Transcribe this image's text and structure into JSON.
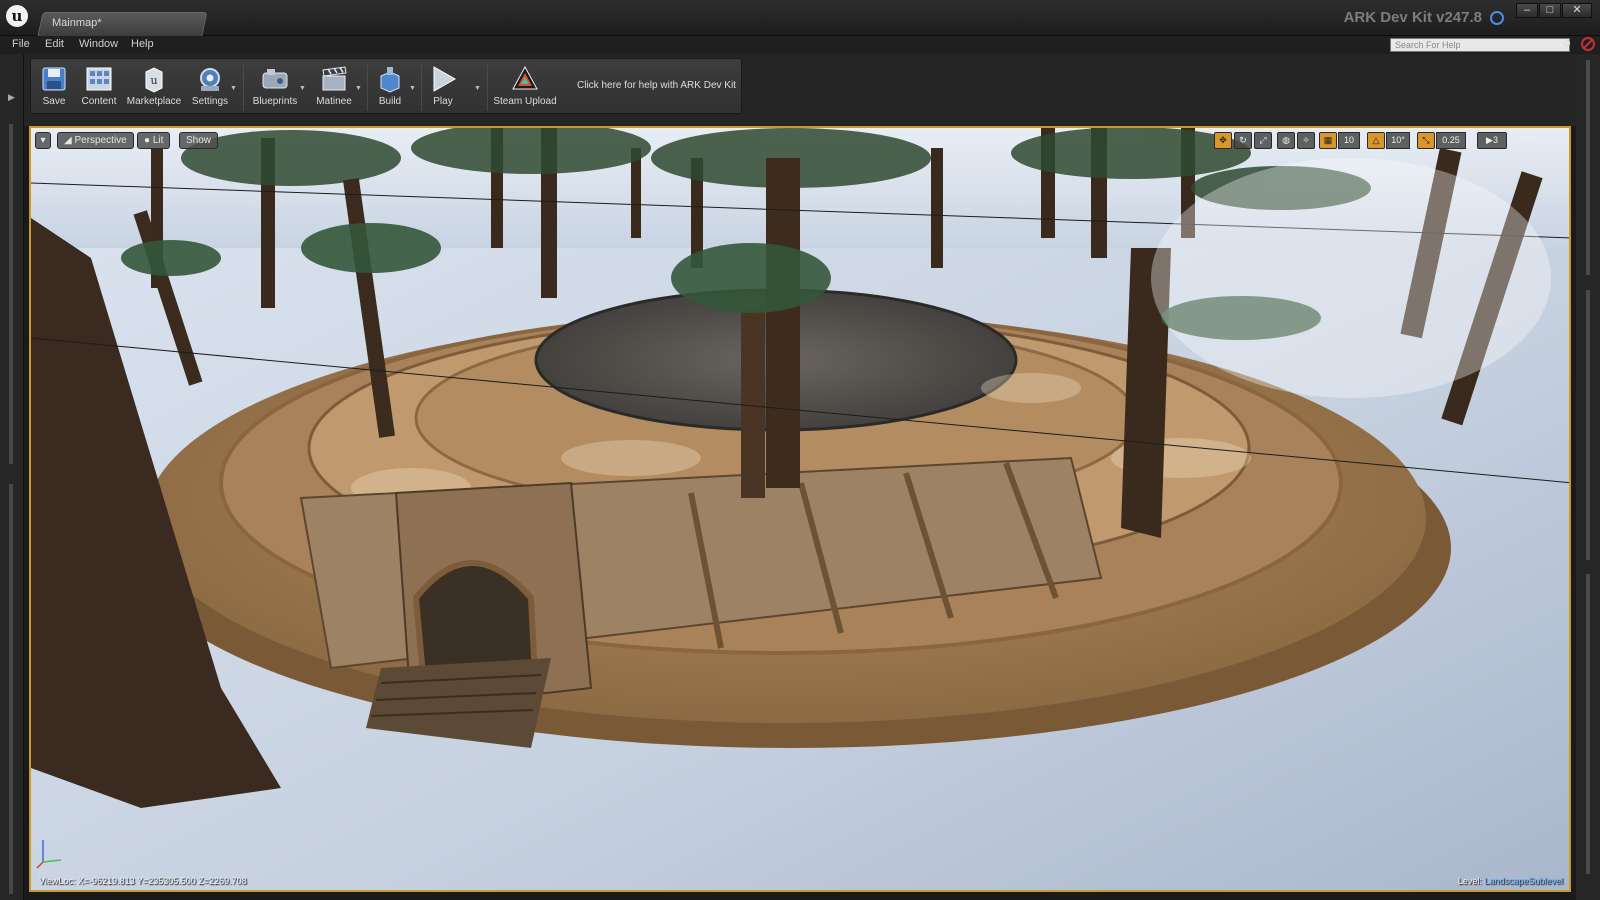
{
  "window": {
    "tab_title": "Mainmap*",
    "app_title": "ARK Dev Kit v247.8",
    "buttons": {
      "minimize": "‒",
      "maximize": "□",
      "close": "✕"
    }
  },
  "menu": {
    "items": [
      "File",
      "Edit",
      "Window",
      "Help"
    ],
    "search_placeholder": "Search For Help"
  },
  "toolbar": {
    "buttons": [
      {
        "label": "Save",
        "icon": "save-icon"
      },
      {
        "label": "Content",
        "icon": "content-icon"
      },
      {
        "label": "Marketplace",
        "icon": "marketplace-icon"
      },
      {
        "label": "Settings",
        "icon": "settings-icon"
      },
      {
        "label": "Blueprints",
        "icon": "blueprints-icon"
      },
      {
        "label": "Matinee",
        "icon": "matinee-icon"
      },
      {
        "label": "Build",
        "icon": "build-icon"
      },
      {
        "label": "Play",
        "icon": "play-icon"
      },
      {
        "label": "Steam Upload",
        "icon": "steam-upload-icon"
      }
    ],
    "help_link": "Click here for help with ARK Dev Kit"
  },
  "viewport": {
    "view_mode": "Perspective",
    "lighting": "Lit",
    "show": "Show",
    "grid_snap": "10",
    "rotation_snap": "10°",
    "scale_snap": "0.25",
    "camera_speed": "3",
    "view_location": "ViewLoc: X=-96219.813 Y=235305.500 Z=2269.708",
    "level_label": "Level:",
    "level_name": "LandscapeSublevel",
    "accent": "#c99a2a"
  }
}
